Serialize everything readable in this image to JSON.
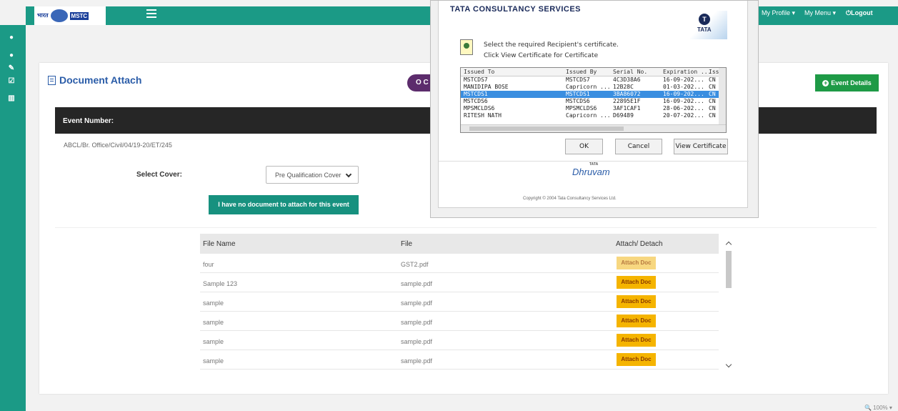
{
  "header": {
    "logo_text_1": "भारत",
    "logo_text_2": "MSTC",
    "my_profile": "My Profile ▾",
    "my_menu": "My Menu ▾",
    "logout": "⏻Logout"
  },
  "page": {
    "title": "Document Attach",
    "purple_button": "O C",
    "event_details_button": "Event Details",
    "event_number_label": "Event Number:",
    "event_number": "ABCL/Br. Office/Civil/04/19-20/ET/245",
    "select_cover_label": "Select Cover:",
    "select_cover_value": "Pre Qualification Cover",
    "no_document_button": "I have no document to attach for this event"
  },
  "table": {
    "headers": [
      "File Name",
      "File",
      "Attach/ Detach"
    ],
    "rows": [
      {
        "name": "four",
        "file": "GST2.pdf",
        "action": "Attach Doc"
      },
      {
        "name": "Sample 123",
        "file": "sample.pdf",
        "action": "Attach Doc"
      },
      {
        "name": "sample",
        "file": "sample.pdf",
        "action": "Attach Doc"
      },
      {
        "name": "sample",
        "file": "sample.pdf",
        "action": "Attach Doc"
      },
      {
        "name": "sample",
        "file": "sample.pdf",
        "action": "Attach Doc"
      },
      {
        "name": "sample",
        "file": "sample.pdf",
        "action": "Attach Doc"
      }
    ]
  },
  "dialog": {
    "brand_title": "TATA CONSULTANCY SERVICES",
    "brand_logo": "TATA",
    "message_1": "Select the required Recipient's certificate.",
    "message_2": "Click View Certificate for Certificate",
    "columns": [
      "Issued To",
      "Issued By",
      "Serial No.",
      "Expiration ...",
      "Iss ^"
    ],
    "certificates": [
      {
        "to": "MSTCDS7",
        "by": "MSTCDS7",
        "serial": "4C3D38A6",
        "exp": "16-09-202...",
        "iss": "CN"
      },
      {
        "to": "MANIDIPA BOSE",
        "by": "Capricorn ...",
        "serial": "12B28C",
        "exp": "01-03-202...",
        "iss": "CN"
      },
      {
        "to": "MSTCDS1",
        "by": "MSTCDS1",
        "serial": "3BA86072",
        "exp": "16-09-202...",
        "iss": "CN"
      },
      {
        "to": "MSTCDS6",
        "by": "MSTCDS6",
        "serial": "22895E1F",
        "exp": "16-09-202...",
        "iss": "CN"
      },
      {
        "to": "MPSMCLDS6",
        "by": "MPSMCLDS6",
        "serial": "3AF1CAF1",
        "exp": "28-06-202...",
        "iss": "CN"
      },
      {
        "to": "RITESH NATH",
        "by": "Capricorn ...",
        "serial": "D69489",
        "exp": "20-07-202...",
        "iss": "CN"
      }
    ],
    "ok": "OK",
    "cancel": "Cancel",
    "view_certificate": "View Certificate",
    "dhruvam": "Dhruvam",
    "dhruvam_tata": "TATA",
    "copyright": "Copyright © 2004 Tata Consultancy Services Ltd."
  },
  "status": {
    "zoom": "🔍 100%  ▾"
  }
}
